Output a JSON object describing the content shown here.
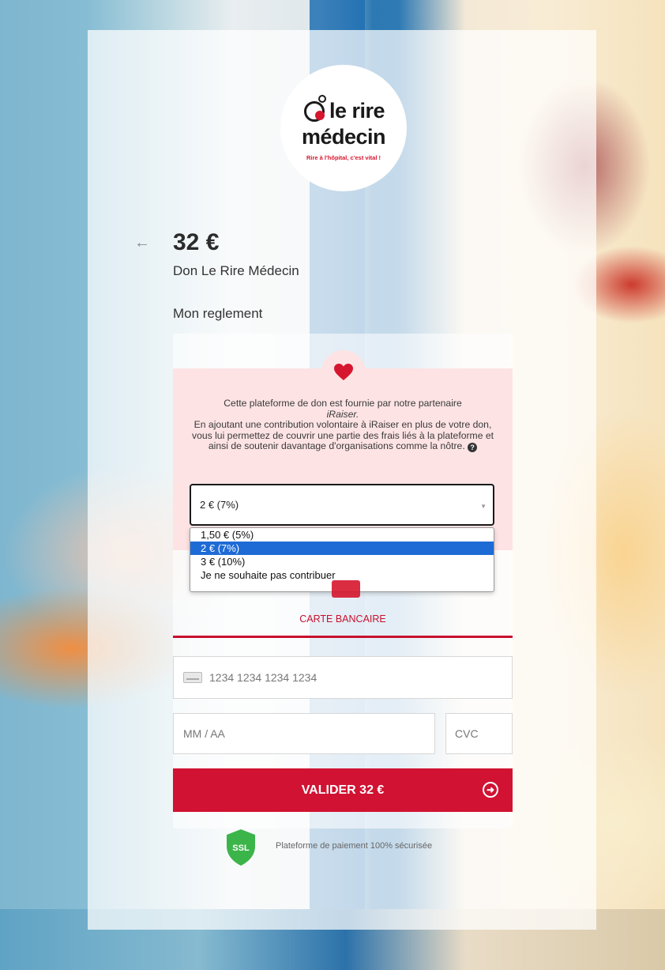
{
  "brand": {
    "logo_word1": "le rire",
    "logo_word2": "médecin",
    "logo_tagline": "Rire à l'hôpital, c'est vital !"
  },
  "header": {
    "back_icon": "arrow-left-icon",
    "amount": "32 €",
    "donation_label": "Don Le Rire Médecin"
  },
  "section_title": "Mon reglement",
  "contribution": {
    "heart_icon": "heart-icon",
    "text_line1": "Cette plateforme de don est fournie par notre partenaire",
    "partner_name": "iRaiser.",
    "text_line2": "En ajoutant une contribution volontaire à iRaiser en plus de votre don, vous lui permettez de couvrir une partie des frais liés à la plateforme et ainsi de soutenir davantage d'organisations comme la nôtre.",
    "help_icon": "question-icon",
    "selected_value": "2 € (7%)",
    "options": [
      {
        "label": "1,50 € (5%)",
        "selected": false
      },
      {
        "label": "2 € (7%)",
        "selected": true
      },
      {
        "label": "3 € (10%)",
        "selected": false
      },
      {
        "label": "Je ne souhaite pas contribuer",
        "selected": false
      }
    ]
  },
  "payment": {
    "method_label": "CARTE BANCAIRE",
    "card_number_placeholder": "1234 1234 1234 1234",
    "expiry_placeholder": "MM / AA",
    "cvc_placeholder": "CVC",
    "submit_label": "VALIDER 32 €",
    "ssl_label": "SSL",
    "secure_text": "Plateforme de paiement 100% sécurisée"
  },
  "colors": {
    "accent": "#d11232",
    "pink_bg": "#fde3e4",
    "selected_option": "#1e6bd6"
  }
}
